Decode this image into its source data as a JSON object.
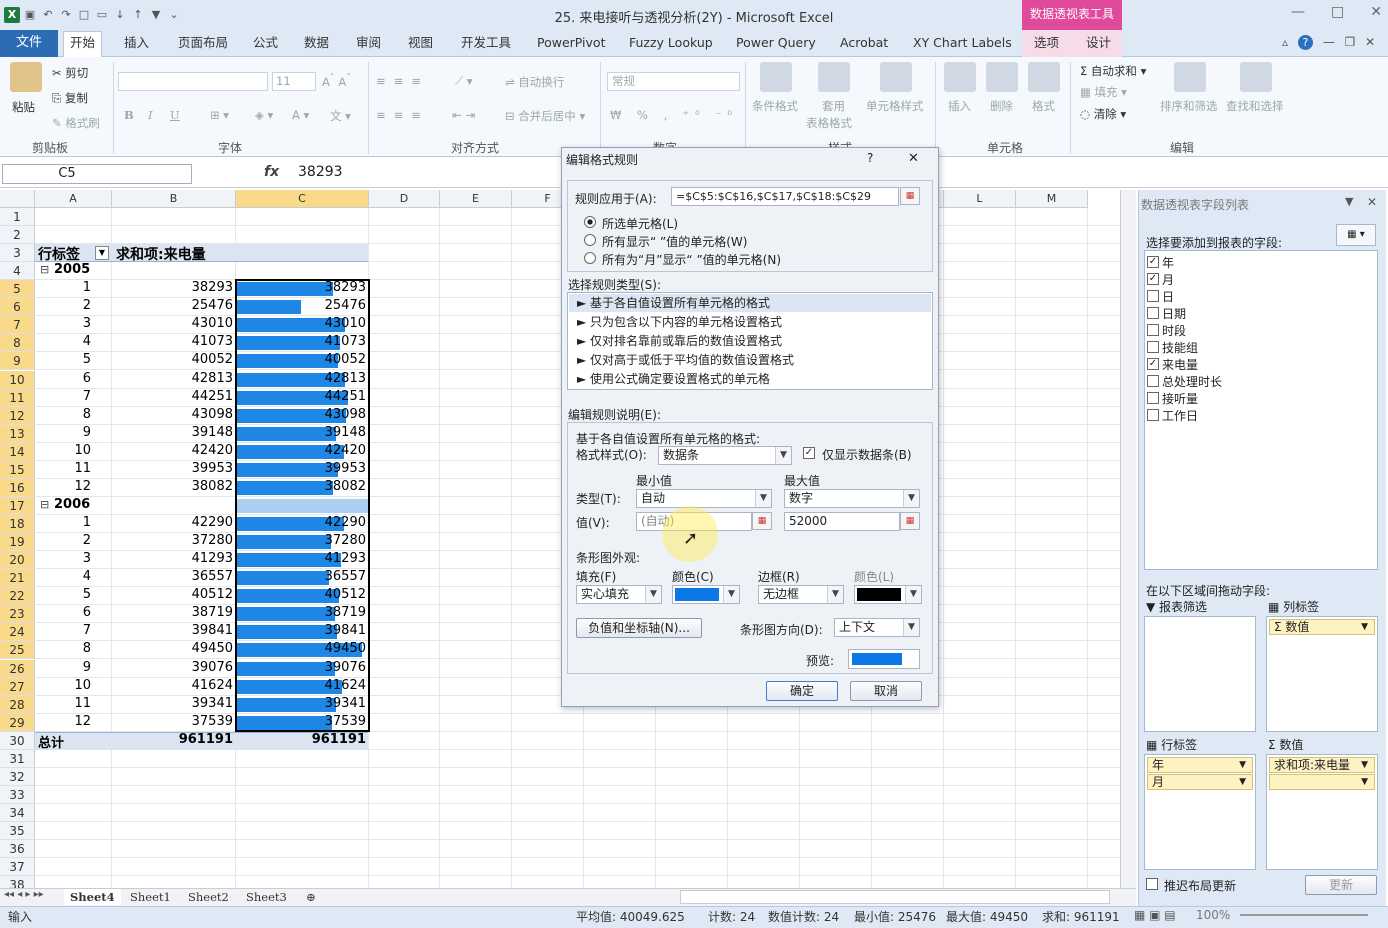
{
  "window": {
    "title": "25. 来电接听与透视分析(2Y) - Microsoft Excel",
    "context_tools": "数据透视表工具"
  },
  "tabs": [
    "文件",
    "开始",
    "插入",
    "页面布局",
    "公式",
    "数据",
    "审阅",
    "视图",
    "开发工具",
    "PowerPivot",
    "Fuzzy Lookup",
    "Power Query",
    "Acrobat",
    "XY Chart Labels",
    "选项",
    "设计"
  ],
  "ribbon": {
    "clipboard": {
      "paste": "粘贴",
      "cut": "剪切",
      "copy": "复制",
      "format_painter": "格式刷",
      "label": "剪贴板"
    },
    "font": {
      "size": "11",
      "bold": "B",
      "italic": "I",
      "underline": "U",
      "label": "字体"
    },
    "align": {
      "wrap": "自动换行",
      "merge": "合并后居中",
      "label": "对齐方式"
    },
    "number": {
      "format": "常规",
      "label": "数字"
    },
    "styles": {
      "conditional": "条件格式",
      "table_line1": "套用",
      "table_line2": "表格格式",
      "cell_styles": "单元格样式",
      "label": "样式"
    },
    "cells": {
      "insert": "插入",
      "delete": "删除",
      "format": "格式",
      "label": "单元格"
    },
    "editing": {
      "autosum": "自动求和",
      "fill": "填充",
      "clear": "清除",
      "sort": "排序和筛选",
      "find": "查找和选择",
      "label": "编辑"
    }
  },
  "formula_bar": {
    "name_box": "C5",
    "fx": "fx",
    "value": "38293"
  },
  "columns": [
    "A",
    "B",
    "C",
    "D",
    "E",
    "F",
    "G",
    "H",
    "I",
    "J",
    "K",
    "L",
    "M"
  ],
  "sheet": {
    "header_row_label": "行标签",
    "header_sum": "求和项:来电量",
    "year1": "2005",
    "year2": "2006",
    "total_label": "总计",
    "total": "961191",
    "data_max": 52000,
    "rows2005": [
      {
        "m": "1",
        "v": 38293
      },
      {
        "m": "2",
        "v": 25476
      },
      {
        "m": "3",
        "v": 43010
      },
      {
        "m": "4",
        "v": 41073
      },
      {
        "m": "5",
        "v": 40052
      },
      {
        "m": "6",
        "v": 42813
      },
      {
        "m": "7",
        "v": 44251
      },
      {
        "m": "8",
        "v": 43098
      },
      {
        "m": "9",
        "v": 39148
      },
      {
        "m": "10",
        "v": 42420
      },
      {
        "m": "11",
        "v": 39953
      },
      {
        "m": "12",
        "v": 38082
      }
    ],
    "rows2006": [
      {
        "m": "1",
        "v": 42290
      },
      {
        "m": "2",
        "v": 37280
      },
      {
        "m": "3",
        "v": 41293
      },
      {
        "m": "4",
        "v": 36557
      },
      {
        "m": "5",
        "v": 40512
      },
      {
        "m": "6",
        "v": 38719
      },
      {
        "m": "7",
        "v": 39841
      },
      {
        "m": "8",
        "v": 49450
      },
      {
        "m": "9",
        "v": 39076
      },
      {
        "m": "10",
        "v": 41624
      },
      {
        "m": "11",
        "v": 39341
      },
      {
        "m": "12",
        "v": 37539
      }
    ]
  },
  "sheet_tabs": [
    "Sheet4",
    "Sheet1",
    "Sheet2",
    "Sheet3"
  ],
  "status": {
    "mode": "输入",
    "avg": "平均值: 40049.625",
    "count": "计数: 24",
    "numcount": "数值计数: 24",
    "min": "最小值: 25476",
    "max": "最大值: 49450",
    "sum": "求和: 961191",
    "zoom": "100%"
  },
  "dialog": {
    "title": "编辑格式规则",
    "help": "?",
    "close": "✕",
    "applies_to_label": "规则应用于(A):",
    "applies_to": "=$C$5:$C$16,$C$17,$C$18:$C$29",
    "radio1": "所选单元格(L)",
    "radio2": "所有显示“ ”值的单元格(W)",
    "radio3": "所有为“月”显示“ ”值的单元格(N)",
    "rule_type_label": "选择规则类型(S):",
    "rule_types": [
      "基于各自值设置所有单元格的格式",
      "只为包含以下内容的单元格设置格式",
      "仅对排名靠前或靠后的数值设置格式",
      "仅对高于或低于平均值的数值设置格式",
      "使用公式确定要设置格式的单元格"
    ],
    "edit_label": "编辑规则说明(E):",
    "desc": "基于各自值设置所有单元格的格式:",
    "style_label": "格式样式(O):",
    "style": "数据条",
    "show_bar_only": "仅显示数据条(B)",
    "min_label": "最小值",
    "max_label": "最大值",
    "type_label": "类型(T):",
    "min_type": "自动",
    "max_type": "数字",
    "value_label": "值(V):",
    "min_value": "(自动)",
    "max_value": "52000",
    "appearance": "条形图外观:",
    "fill_label": "填充(F)",
    "fill": "实心填充",
    "color_label": "颜色(C)",
    "border_label": "边框(R)",
    "border": "无边框",
    "border_color_label": "颜色(L)",
    "neg_axis": "负值和坐标轴(N)...",
    "direction_label": "条形图方向(D):",
    "direction": "上下文",
    "preview_label": "预览:",
    "ok": "确定",
    "cancel": "取消",
    "bar_color": "#0a78e6"
  },
  "panel": {
    "title": "数据透视表字段列表",
    "choose": "选择要添加到报表的字段:",
    "fields": [
      {
        "n": "年",
        "c": true
      },
      {
        "n": "月",
        "c": true
      },
      {
        "n": "日",
        "c": false
      },
      {
        "n": "日期",
        "c": false
      },
      {
        "n": "时段",
        "c": false
      },
      {
        "n": "技能组",
        "c": false
      },
      {
        "n": "来电量",
        "c": true
      },
      {
        "n": "总处理时长",
        "c": false
      },
      {
        "n": "接听量",
        "c": false
      },
      {
        "n": "工作日",
        "c": false
      }
    ],
    "drag_label": "在以下区域间拖动字段:",
    "filter": "报表筛选",
    "col_labels": "列标签",
    "col_value": "数值",
    "row_labels": "行标签",
    "values": "数值",
    "row_items": [
      "年",
      "月"
    ],
    "value_item": "求和项:来电量",
    "defer": "推迟布局更新",
    "update": "更新"
  }
}
